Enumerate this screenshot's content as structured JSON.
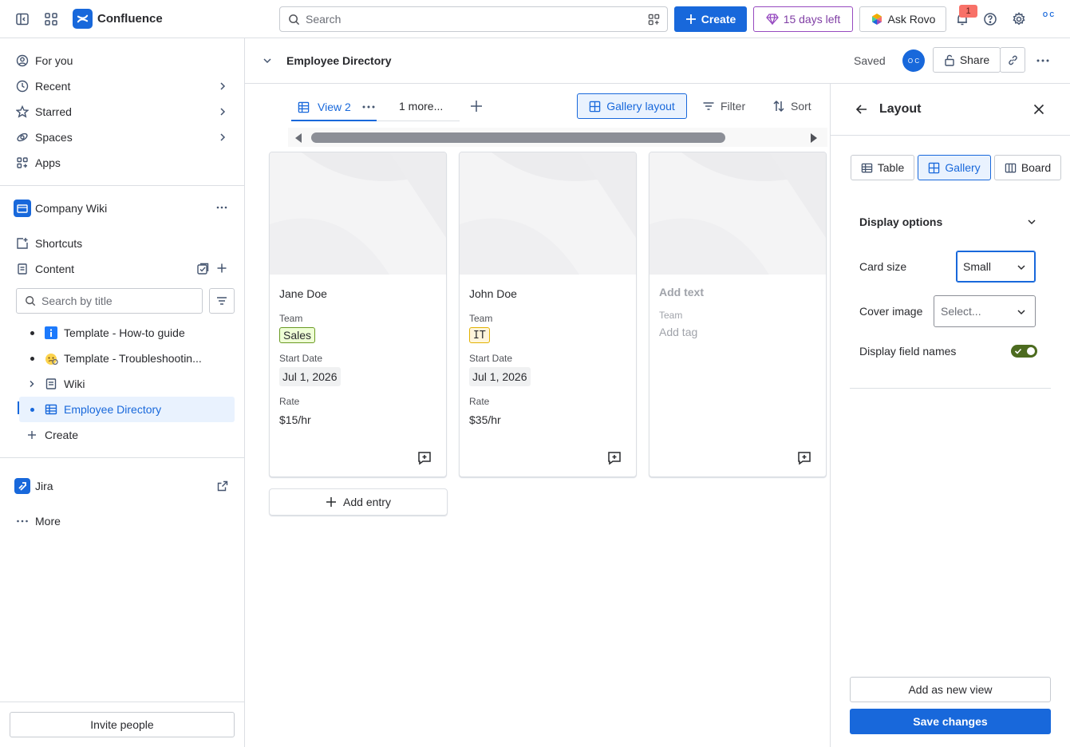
{
  "topbar": {
    "brand": "Confluence",
    "search_placeholder": "Search",
    "create_label": "Create",
    "trial_label": "15 days left",
    "rovo_label": "Ask Rovo",
    "notification_count": "1",
    "profile_initials": "O C"
  },
  "sidebar": {
    "nav": [
      {
        "label": "For you",
        "icon": "user-circle-icon"
      },
      {
        "label": "Recent",
        "icon": "clock-icon"
      },
      {
        "label": "Starred",
        "icon": "star-icon"
      },
      {
        "label": "Spaces",
        "icon": "spaces-icon"
      },
      {
        "label": "Apps",
        "icon": "apps-icon"
      }
    ],
    "space_name": "Company Wiki",
    "shortcuts_label": "Shortcuts",
    "content_label": "Content",
    "search_placeholder": "Search by title",
    "tree": [
      {
        "label": "Template - How-to guide",
        "icon": "info-icon"
      },
      {
        "label": "Template - Troubleshootin...",
        "icon": "face-emoji-icon"
      },
      {
        "label": "Wiki",
        "icon": "page-icon"
      },
      {
        "label": "Employee Directory",
        "icon": "database-icon"
      }
    ],
    "create_label": "Create",
    "jira_label": "Jira",
    "more_label": "More",
    "invite_label": "Invite people"
  },
  "page": {
    "title": "Employee Directory",
    "saved_label": "Saved",
    "share_label": "Share",
    "avatar_initials": "O C"
  },
  "database": {
    "active_view": "View 2",
    "more_views": "1 more...",
    "layout_button": "Gallery layout",
    "filter_label": "Filter",
    "sort_label": "Sort",
    "add_entry_label": "Add entry",
    "cards": [
      {
        "name": "Jane Doe",
        "team_label": "Team",
        "team": "Sales",
        "start_label": "Start Date",
        "start": "Jul 1, 2026",
        "rate_label": "Rate",
        "rate": "$15/hr"
      },
      {
        "name": "John Doe",
        "team_label": "Team",
        "team": "IT",
        "start_label": "Start Date",
        "start": "Jul 1, 2026",
        "rate_label": "Rate",
        "rate": "$35/hr"
      },
      {
        "name": "Add text",
        "team_label": "Team",
        "team": "Add tag"
      }
    ]
  },
  "panel": {
    "title": "Layout",
    "layouts": [
      "Table",
      "Gallery",
      "Board"
    ],
    "selected_layout": "Gallery",
    "display_options_label": "Display options",
    "card_size_label": "Card size",
    "card_size_value": "Small",
    "cover_image_label": "Cover image",
    "cover_image_placeholder": "Select...",
    "display_field_names_label": "Display field names",
    "display_field_names_on": true,
    "add_view_label": "Add as new view",
    "save_label": "Save changes"
  },
  "colors": {
    "accent": "#1868db",
    "selected_bg": "#e9f2fe",
    "toggle_on": "#4c6b1f",
    "trial_purple": "#803fa5"
  }
}
